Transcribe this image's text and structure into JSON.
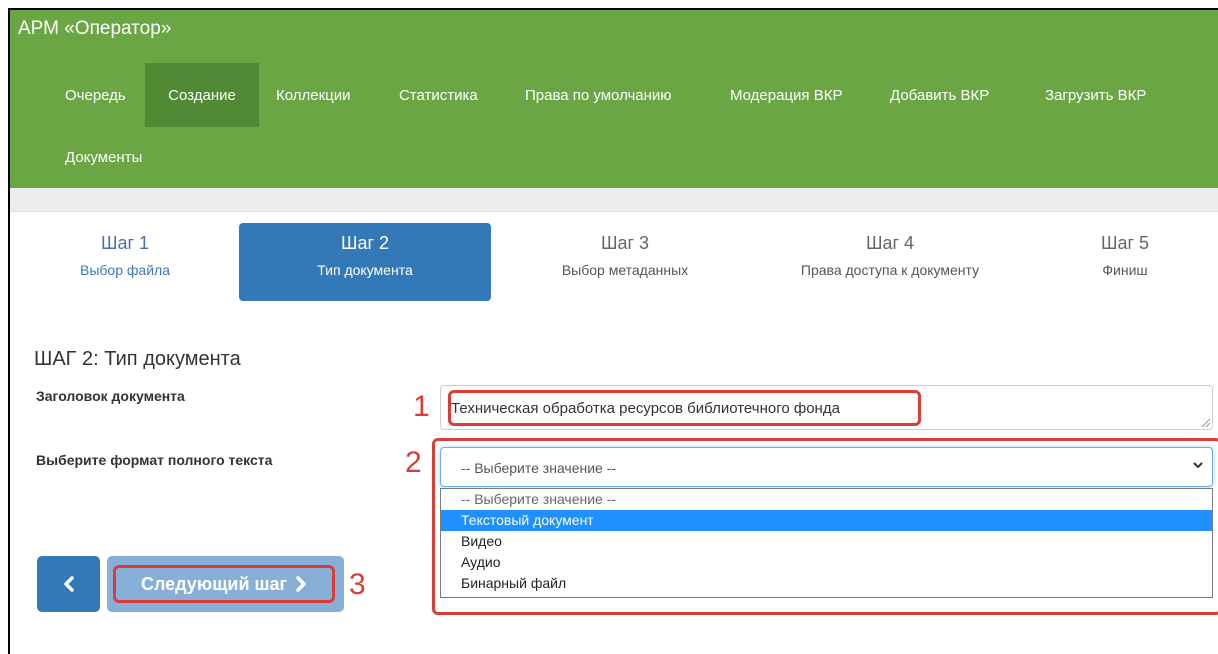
{
  "app": {
    "title": "АРМ «Оператор»"
  },
  "nav": {
    "items": [
      {
        "label": "Очередь",
        "active": false
      },
      {
        "label": "Создание",
        "active": true
      },
      {
        "label": "Коллекции",
        "active": false
      },
      {
        "label": "Статистика",
        "active": false
      },
      {
        "label": "Права по умолчанию",
        "active": false
      },
      {
        "label": "Модерация ВКР",
        "active": false
      },
      {
        "label": "Добавить ВКР",
        "active": false
      },
      {
        "label": "Загрузить ВКР",
        "active": false
      },
      {
        "label": "Документы",
        "active": false
      }
    ]
  },
  "steps": [
    {
      "number": "Шаг 1",
      "label": "Выбор файла",
      "state": "done"
    },
    {
      "number": "Шаг 2",
      "label": "Тип документа",
      "state": "active"
    },
    {
      "number": "Шаг 3",
      "label": "Выбор метаданных",
      "state": "inactive"
    },
    {
      "number": "Шаг 4",
      "label": "Права доступа к документу",
      "state": "inactive"
    },
    {
      "number": "Шаг 5",
      "label": "Финиш",
      "state": "inactive"
    }
  ],
  "form": {
    "section_title": "ШАГ 2: Тип документа",
    "title_label": "Заголовок документа",
    "title_value": "Техническая обработка ресурсов библиотечного фонда",
    "format_label": "Выберите формат полного текста",
    "format_selected": "-- Выберите значение --",
    "format_options": [
      "-- Выберите значение --",
      "Текстовый документ",
      "Видео",
      "Аудио",
      "Бинарный файл"
    ],
    "highlighted_option": "Текстовый документ"
  },
  "buttons": {
    "back_icon": "chevron-left-icon",
    "next_label": "Следующий шаг",
    "next_icon": "chevron-right-icon"
  },
  "annotations": {
    "marker_1": "1",
    "marker_2": "2",
    "marker_3": "3"
  },
  "colors": {
    "header_bg": "#6aa644",
    "nav_active_bg": "#518a35",
    "step_active_bg": "#3479b7",
    "annotation_red": "#dd3b36",
    "option_highlight": "#1e90ff"
  }
}
